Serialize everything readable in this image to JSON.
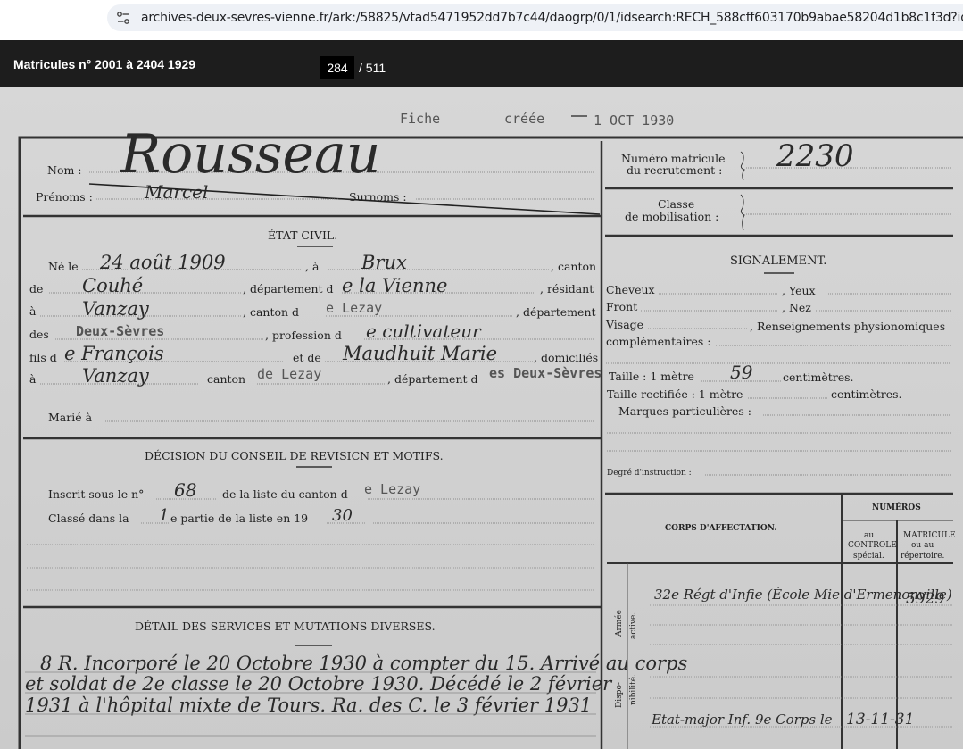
{
  "browser": {
    "url": "archives-deux-sevres-vienne.fr/ark:/58825/vtad5471952dd7b7c44/daogrp/0/1/idsearch:RECH_588cff603170b9abae58204d1b8c1f3d?id=htt..."
  },
  "viewer": {
    "title": "Matricules n° 2001 à 2404 1929",
    "current_page": "284",
    "total_pages": "/ 511"
  },
  "document": {
    "stamp_fiche": "Fiche",
    "stamp_creee": "créée",
    "stamp_date": "1 OCT 1930",
    "nom_label": "Nom :",
    "nom_value": "Rousseau",
    "prenoms_label": "Prénoms :",
    "prenoms_value": "Marcel",
    "surnoms_label": "Surnoms :",
    "numero_label_1": "Numéro matricule",
    "numero_label_2": "du recrutement :",
    "numero_value": "2230",
    "classe_label_1": "Classe",
    "classe_label_2": "de mobilisation :",
    "etat_civil_title": "ÉTAT CIVIL.",
    "ne_le": "Né le",
    "birth_date": "24 août 1909",
    "a_label": ", à",
    "birth_place": "Brux",
    "canton_label": ", canton",
    "de_label": "de",
    "canton_value": "Couhé",
    "departement_label": ", département d",
    "departement_value": "e la Vienne",
    "residant_label": ", résidant",
    "a2_label": "à",
    "residence": "Vanzay",
    "canton2_label": ", canton d",
    "canton2_value": "e Lezay",
    "departement2_label": ", département",
    "des_label": "des",
    "departement2_value": "Deux-Sèvres",
    "profession_label": ", profession d",
    "profession_value": "e cultivateur",
    "fils_label": "fils d",
    "father": "e François",
    "et_de_label": "et de",
    "mother": "Maudhuit Marie",
    "domicilies_label": ", domiciliés",
    "a3_label": "à",
    "domicile": "Vanzay",
    "canton3_label": "canton",
    "canton3_value": "de Lezay",
    "departement3_label": ", département d",
    "departement3_value": "es Deux-Sèvres",
    "marie_label": "Marié à",
    "conseil_title": "DÉCISION DU CONSEIL DE REVISICN ET MOTIFS.",
    "inscrit_label": "Inscrit sous le n°",
    "inscrit_value": "68",
    "liste_label": "de la liste du canton d",
    "liste_value": "e Lezay",
    "classe_dans_label": "Classé dans la",
    "partie_value": "1",
    "partie_label": "e partie de la liste en 19",
    "annee_value": "30",
    "services_title": "DÉTAIL DES SERVICES ET MUTATIONS DIVERSES.",
    "services_line1": "8 R. Incorporé le 20 Octobre 1930 à compter du 15. Arrivé au corps",
    "services_line2": "et soldat de 2e classe le 20 Octobre 1930. Décédé le 2 février",
    "services_line3": "1931 à l'hôpital mixte de Tours. Ra. des C. le 3 février 1931",
    "signalement_title": "SIGNALEMENT.",
    "cheveux": "Cheveux",
    "yeux": ", Yeux",
    "front": "Front",
    "nez": ", Nez",
    "visage": "Visage",
    "renseignements": ", Renseignements physionomiques",
    "complementaires": "complémentaires :",
    "taille_label": "Taille : 1 mètre",
    "taille_value": "59",
    "centimetres": "centimètres.",
    "taille_rect_label": "Taille rectifiée : 1 mètre",
    "centimetres2": "centimètres.",
    "marques": "Marques particulières :",
    "degre": "Degré d'instruction :",
    "numeros_title": "NUMÉROS",
    "corps_title": "CORPS D'AFFECTATION.",
    "au_controle_1": "au",
    "au_controle_2": "CONTROLE",
    "au_controle_3": "spécial.",
    "matricule_1": "MATRICULE",
    "matricule_2": "ou au",
    "matricule_3": "répertoire.",
    "armee_active_1": "Armée",
    "armee_active_2": "active.",
    "corps_value": "32e Régt d'Infie (École Mie d'Ermenonville)",
    "matricule_value": "5929",
    "dispo_1": "Dispo-",
    "dispo_2": "nibilité.",
    "dispo_value": "Etat-major Inf. 9e Corps le",
    "dispo_date": "13-11-31"
  }
}
